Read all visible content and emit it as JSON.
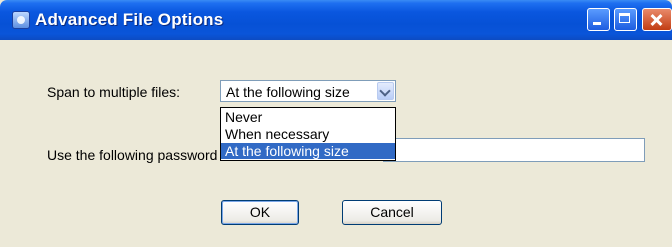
{
  "window": {
    "title": "Advanced File Options",
    "controls": [
      "minimize-icon",
      "maximize-icon",
      "close-icon"
    ]
  },
  "form": {
    "span_label": "Span to multiple files:",
    "span_selected": "At the following size",
    "span_options": [
      "Never",
      "When necessary",
      "At the following size"
    ],
    "password_label": "Use the following password",
    "password_value": ""
  },
  "buttons": {
    "ok": "OK",
    "cancel": "Cancel"
  },
  "colors": {
    "titlebar": "#0a57df",
    "selection": "#316ac5",
    "dialog_bg": "#ece9d8"
  }
}
